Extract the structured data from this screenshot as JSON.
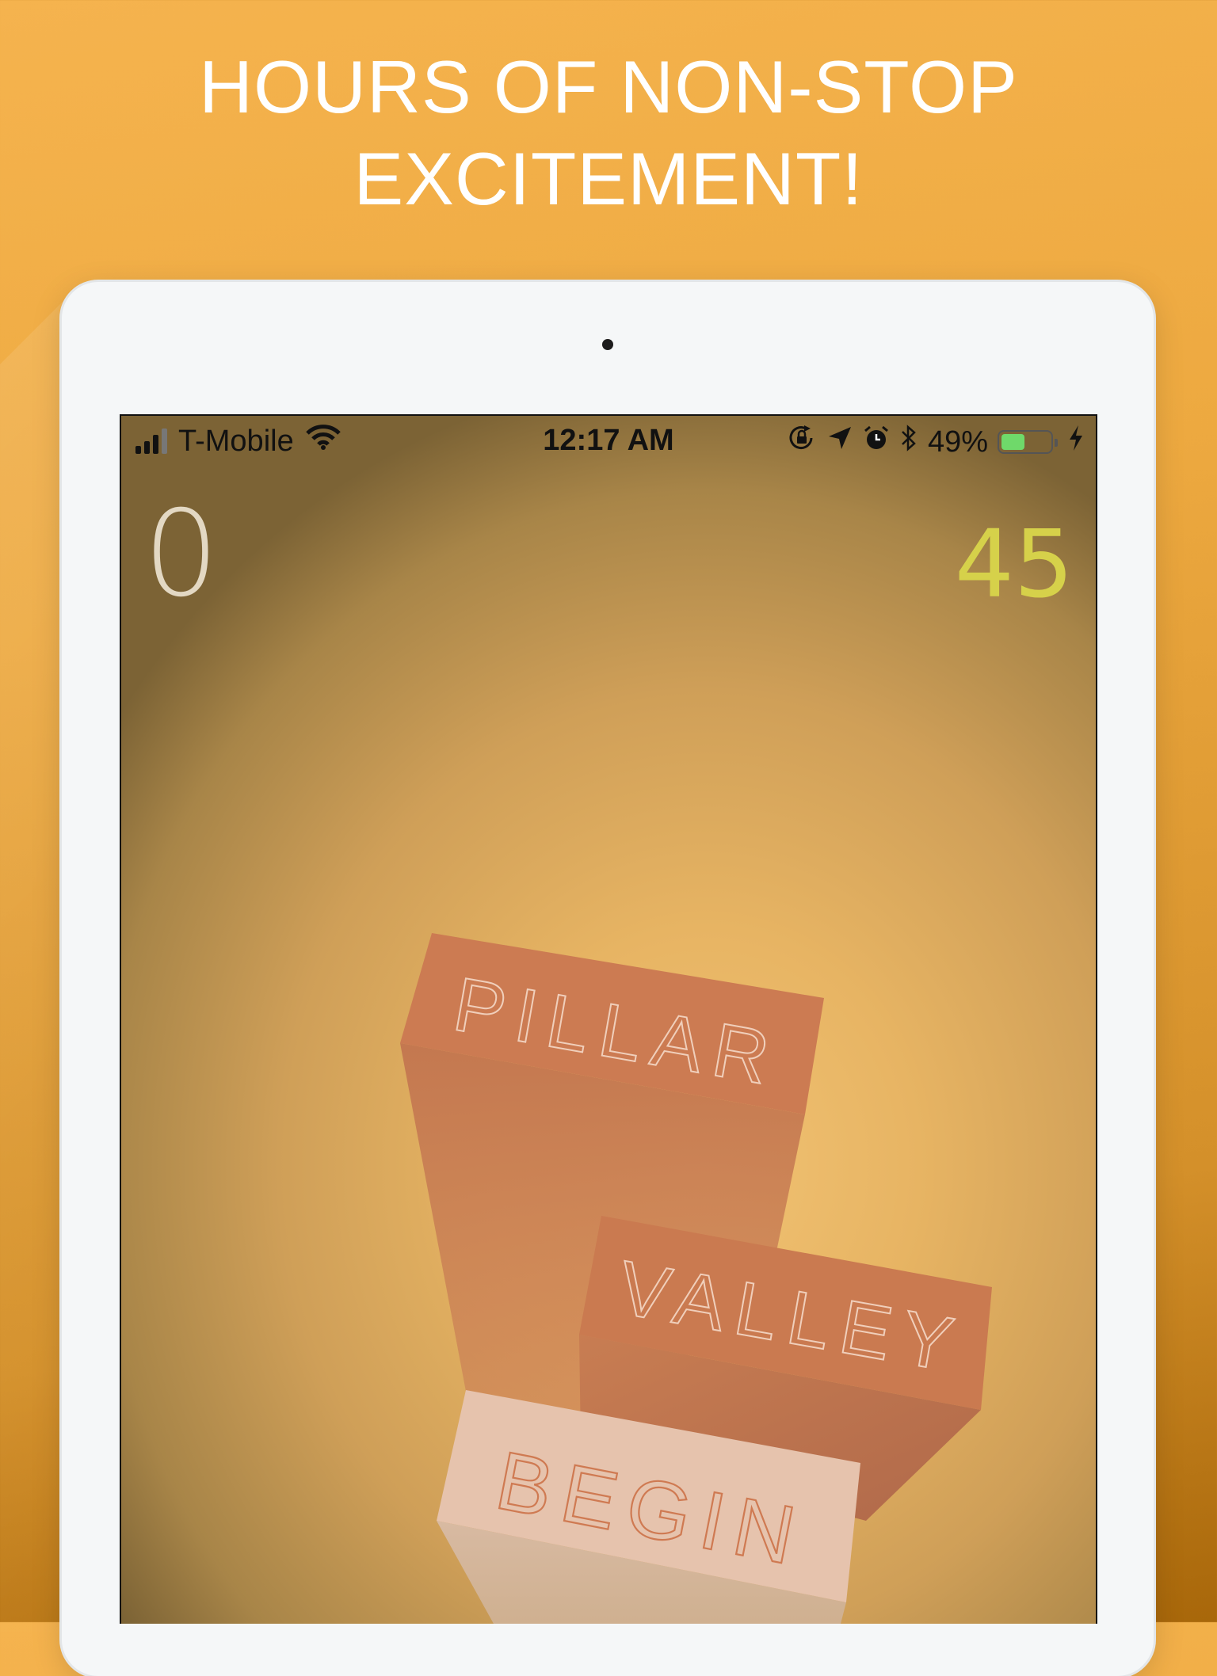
{
  "headline": {
    "line1": "HOURS OF NON-STOP",
    "line2": "EXCITEMENT!"
  },
  "status_bar": {
    "carrier": "T-Mobile",
    "time": "12:17 AM",
    "battery_percent": "49%",
    "battery_level": 0.49,
    "icons": [
      "signal-icon",
      "wifi-icon",
      "rotation-lock-icon",
      "location-icon",
      "alarm-icon",
      "bluetooth-icon",
      "battery-icon",
      "charging-icon"
    ]
  },
  "game": {
    "score": "0",
    "best": "45",
    "blocks": {
      "pillar": "PILLAR",
      "valley": "VALLEY",
      "begin": "BEGIN"
    }
  },
  "colors": {
    "background_top": "#f5b34e",
    "background_bottom": "#a8670a",
    "block_color": "#cf7d52",
    "begin_block_color": "#e8c6b0",
    "best_score_color": "#d6d14a",
    "score_color": "#e3d8c3"
  }
}
